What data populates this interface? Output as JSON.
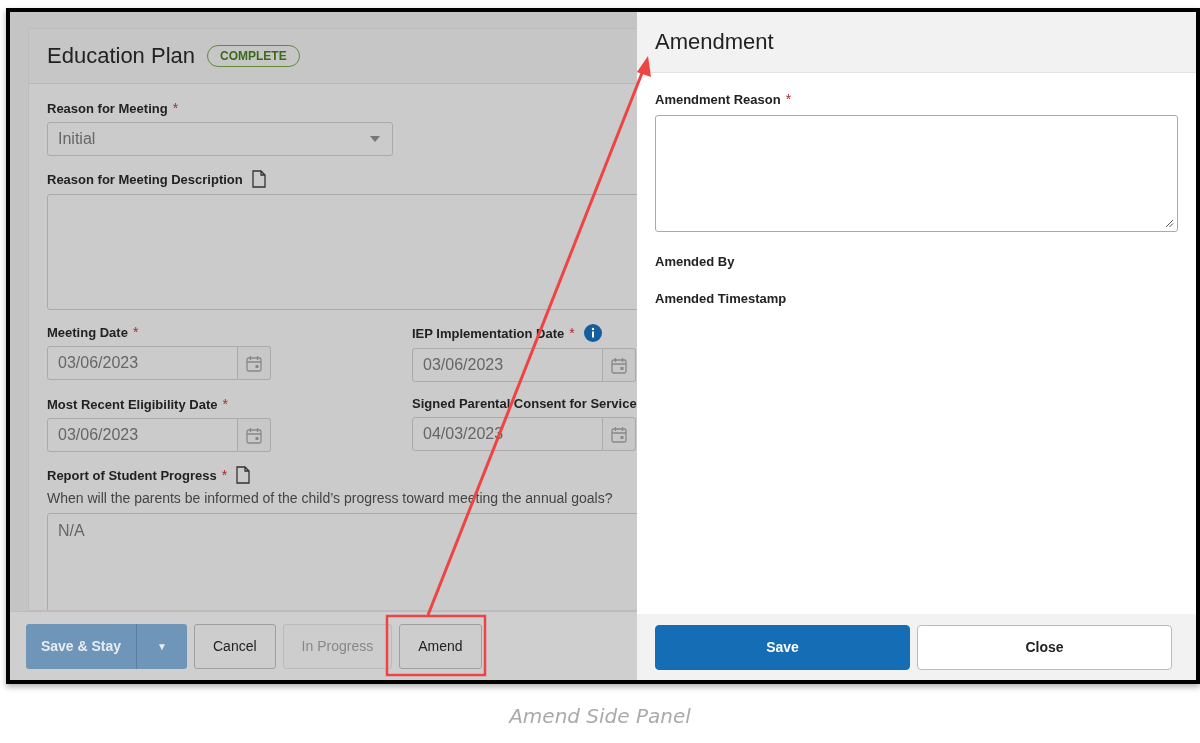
{
  "plan": {
    "title": "Education Plan",
    "status": "COMPLETE",
    "rows": [
      [
        {
          "kind": "select",
          "label": "Reason for Meeting",
          "required": "*",
          "value": "Initial"
        }
      ],
      [
        {
          "kind": "textarea",
          "label": "Reason for Meeting Description",
          "note_icon": true
        }
      ],
      [
        {
          "kind": "date",
          "label": "Meeting Date",
          "required": "*",
          "value": "03/06/2023"
        },
        {
          "kind": "date",
          "label": "IEP Implementation Date",
          "required": "*",
          "info_icon": true,
          "value": "03/06/2023"
        }
      ],
      [
        {
          "kind": "date",
          "label": "Most Recent Eligibility Date",
          "required": "*",
          "value": "03/06/2023"
        },
        {
          "kind": "date",
          "label": "Signed Parental Consent for Service",
          "value": "04/03/2023"
        }
      ],
      [
        {
          "kind": "textarea",
          "label": "Report of Student Progress",
          "required": "*",
          "note_icon": true,
          "hint": "When will the parents be informed of the child’s progress toward meeting the annual goals?",
          "value": "N/A"
        }
      ]
    ],
    "buttons": [
      {
        "kind": "split",
        "label": "Save & Stay",
        "caret": "▼",
        "disabled": false
      },
      {
        "kind": "default",
        "label": "Cancel",
        "disabled": false
      },
      {
        "kind": "default",
        "label": "In Progress",
        "disabled": true
      },
      {
        "kind": "default",
        "label": "Amend",
        "disabled": false,
        "highlighted": true
      }
    ]
  },
  "panel": {
    "title": "Amendment",
    "fields": [
      {
        "kind": "textarea",
        "label": "Amendment Reason",
        "required": "*"
      },
      {
        "kind": "text",
        "label": "Amended By"
      },
      {
        "kind": "text",
        "label": "Amended Timestamp"
      }
    ],
    "buttons": [
      {
        "kind": "primary",
        "label": "Save"
      },
      {
        "kind": "default",
        "label": "Close"
      }
    ]
  },
  "caption": "Amend Side Panel"
}
